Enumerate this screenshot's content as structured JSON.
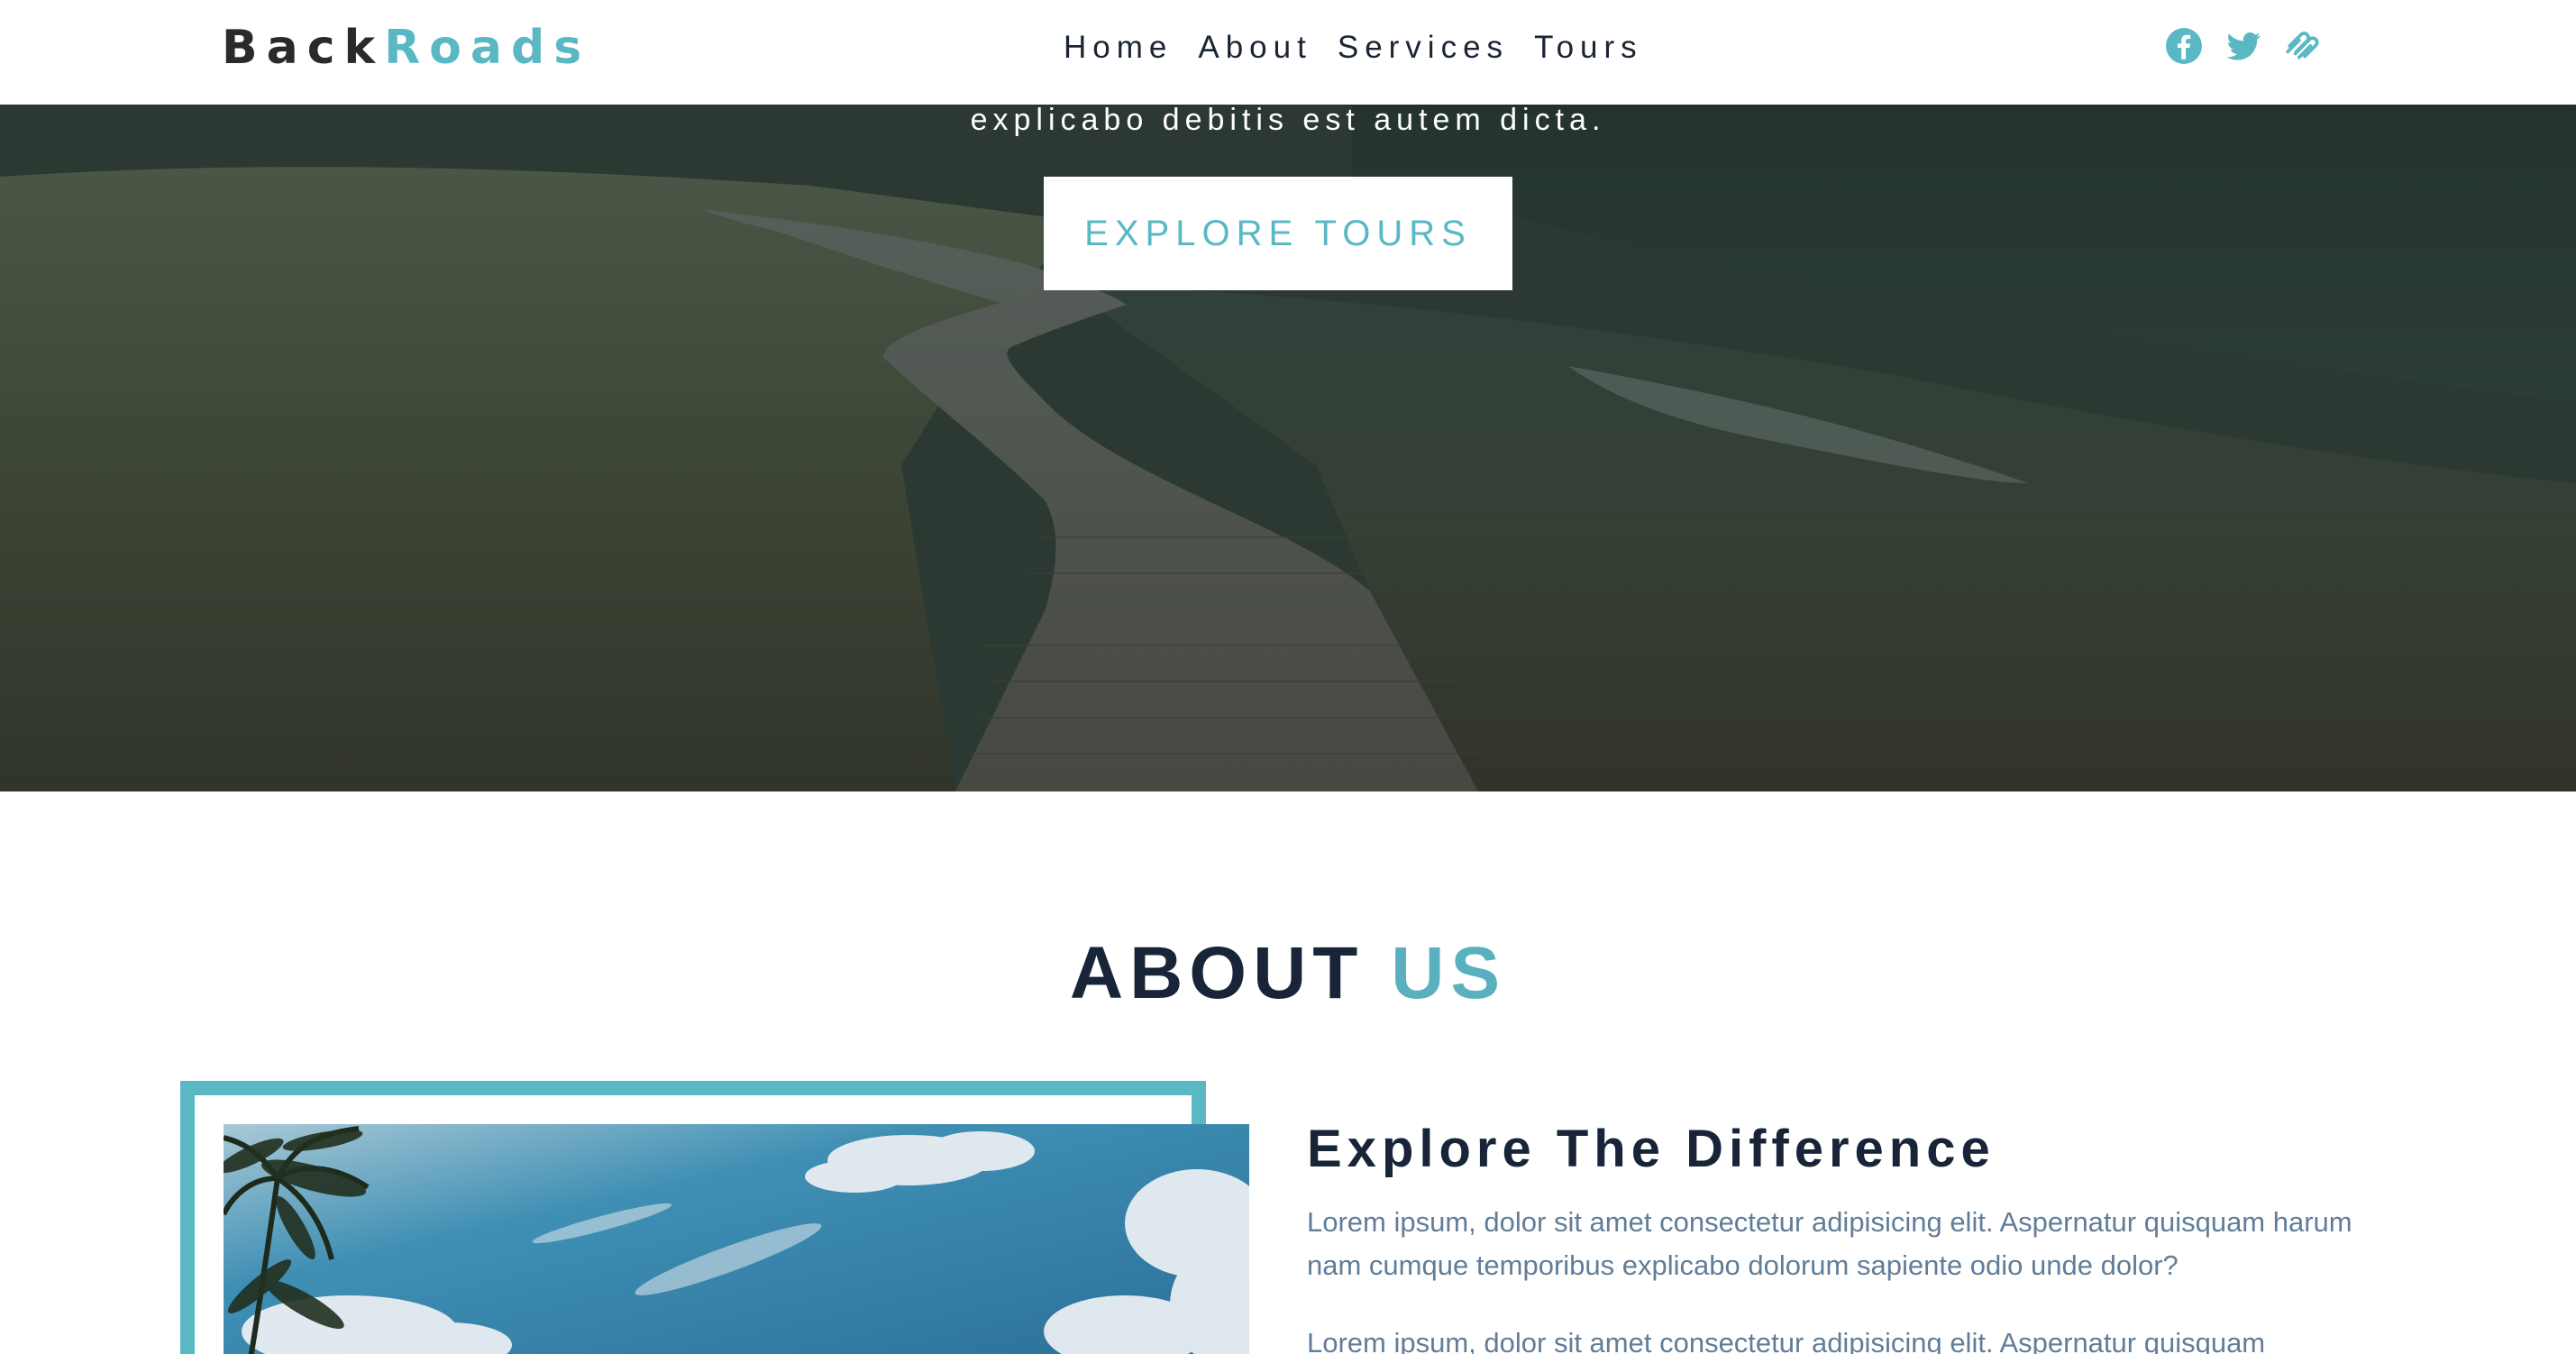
{
  "navbar": {
    "logo_part1": "Back",
    "logo_part2": "Roads",
    "links": [
      "Home",
      "About",
      "Services",
      "Tours"
    ],
    "social_icons": [
      "facebook-icon",
      "twitter-icon",
      "squarespace-icon"
    ]
  },
  "hero": {
    "text_line": "explicabo debitis est autem dicta.",
    "button_label": "EXPLORE TOURS"
  },
  "about": {
    "title_part1": "ABOUT ",
    "title_part2": "US",
    "heading": "Explore The Difference",
    "paragraph1": "Lorem ipsum, dolor sit amet consectetur adipisicing elit. Aspernatur quisquam harum nam cumque temporibus explicabo dolorum sapiente odio unde dolor?",
    "paragraph2": "Lorem ipsum, dolor sit amet consectetur adipisicing elit. Aspernatur quisquam"
  },
  "colors": {
    "accent": "#5ab8c4",
    "dark": "#182538",
    "text_grey": "#617d98"
  }
}
